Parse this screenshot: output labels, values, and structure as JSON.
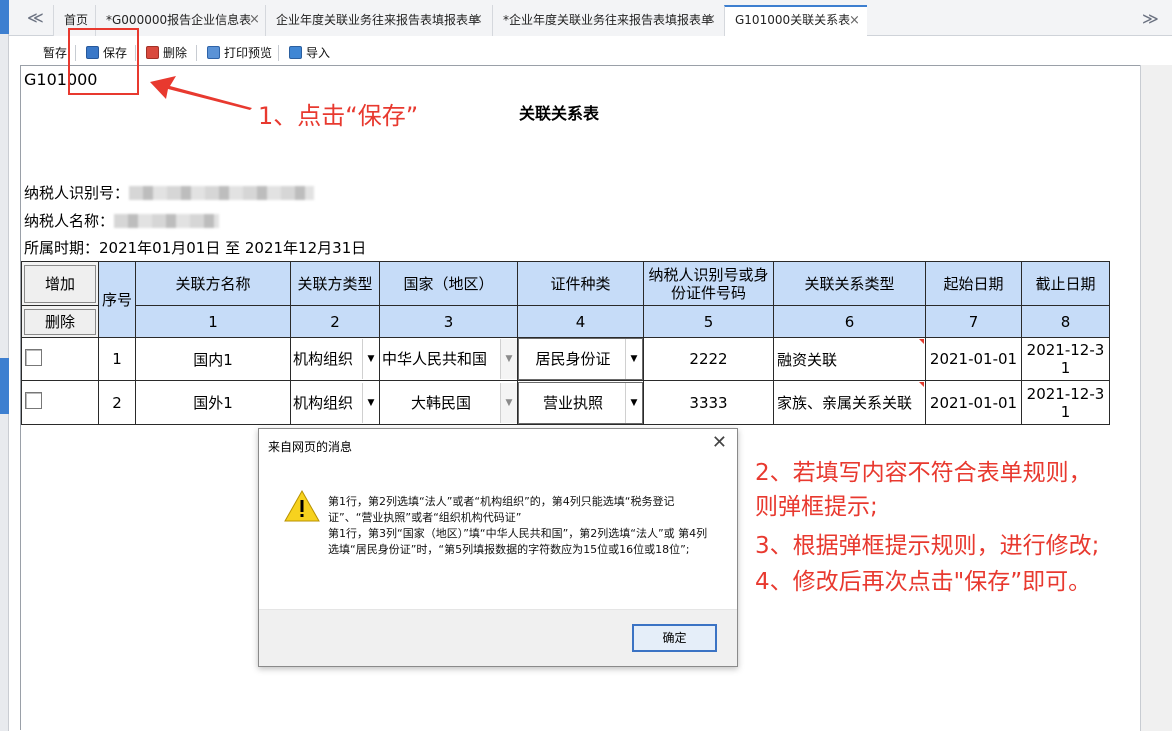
{
  "tabs": {
    "nav_left": "≪",
    "nav_right": "≫",
    "items": [
      {
        "label": "首页",
        "close": ""
      },
      {
        "label": "*G000000报告企业信息表",
        "close": "×"
      },
      {
        "label": "企业年度关联业务往来报告表填报表单",
        "close": "×"
      },
      {
        "label": "*企业年度关联业务往来报告表填报表单",
        "close": "×"
      },
      {
        "label": "G101000关联关系表",
        "close": "×"
      }
    ]
  },
  "toolbar": {
    "temp_save": "暂存",
    "save": "保存",
    "delete": "删除",
    "print_preview": "打印预览",
    "import": "导入"
  },
  "form": {
    "id": "G101000",
    "title": "关联关系表",
    "taxpayer_id_label": "纳税人识别号：",
    "taxpayer_name_label": "纳税人名称：",
    "period_label": "所属时期：2021年01月01日 至 2021年12月31日"
  },
  "table": {
    "add_btn": "增加",
    "delete_btn": "删除",
    "seq_header": "序号",
    "columns": [
      "关联方名称",
      "关联方类型",
      "国家（地区）",
      "证件种类",
      "纳税人识别号或身份证件号码",
      "关联关系类型",
      "起始日期",
      "截止日期"
    ],
    "col_numbers": [
      "1",
      "2",
      "3",
      "4",
      "5",
      "6",
      "7",
      "8"
    ],
    "rows": [
      {
        "seq": "1",
        "name": "国内1",
        "type": "机构组织",
        "country": "中华人民共和国",
        "cert": "居民身份证",
        "id": "2222",
        "relation": "融资关联",
        "start": "2021-01-01",
        "end": "2021-12-31"
      },
      {
        "seq": "2",
        "name": "国外1",
        "type": "机构组织",
        "country": "大韩民国",
        "cert": "营业执照",
        "id": "3333",
        "relation": "家族、亲属关系关联",
        "start": "2021-01-01",
        "end": "2021-12-31"
      }
    ]
  },
  "annotations": {
    "step1": "1、点击“保存”",
    "step2": "2、若填写内容不符合表单规则，",
    "step2b": "则弹框提示;",
    "step3": "3、根据弹框提示规则，进行修改;",
    "step4": "4、修改后再次点击\"保存”即可。"
  },
  "dialog": {
    "title": "来自网页的消息",
    "close": "✕",
    "message_1": "第1行，第2列选填“法人”或者“机构组织”的，第4列只能选填“税务登记证”、“营业执照”或者“组织机构代码证”",
    "message_2": "第1行，第3列“国家（地区）”填“中华人民共和国”，第2列选填“法人”或 第4列选填“居民身份证”时，“第5列填报数据的字符数应为15位或16位或18位”;",
    "ok": "确定"
  },
  "colors": {
    "accent": "#3d7fd0",
    "annotation_red": "#e8392f",
    "header_blue": "#c6dcf8"
  }
}
